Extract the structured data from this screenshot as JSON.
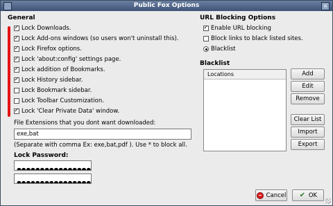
{
  "window": {
    "title": "Public Fox Options"
  },
  "general": {
    "title": "General",
    "options": [
      {
        "label": "Lock Downloads.",
        "checked": true
      },
      {
        "label": "Lock Add-ons windows (so users won't uninstall this).",
        "checked": true
      },
      {
        "label": "Lock Firefox options.",
        "checked": true
      },
      {
        "label": "Lock 'about:config' settings page.",
        "checked": true
      },
      {
        "label": "Lock addition of Bookmarks.",
        "checked": true
      },
      {
        "label": "Lock History sidebar.",
        "checked": true
      },
      {
        "label": "Lock Bookmark sidebar.",
        "checked": false
      },
      {
        "label": "Lock Toolbar Customization.",
        "checked": false
      },
      {
        "label": "Lock 'Clear Private Data' window.",
        "checked": true
      }
    ]
  },
  "extensions": {
    "label": "File Extensions that you dont want downloaded:",
    "value": "exe,bat",
    "help": "(Separate with comma Ex:  exe,bat,pdf ). Use * to block all."
  },
  "lock_password": {
    "label": "Lock Password:",
    "password_mask": "●●●●●●●●●●●●●●●●●●●●",
    "confirm_mask": "●●●●●●●●●●●●●●●●●●●●"
  },
  "url_blocking": {
    "title": "URL Blocking Options",
    "enable_label": "Enable URL blocking",
    "enable_checked": true,
    "block_links_label": "Block links to black listed sites.",
    "block_links_checked": false,
    "blacklist_radio_label": "Blacklist",
    "blacklist_selected": true
  },
  "blacklist": {
    "title": "Blacklist",
    "column_header": "Locations",
    "buttons": {
      "add": "Add",
      "edit": "Edit",
      "remove": "Remove",
      "clear": "Clear List",
      "import": "Import",
      "export": "Export"
    }
  },
  "footer": {
    "cancel": "Cancel",
    "ok": "OK"
  },
  "colors": {
    "accent_bar": "#e31414",
    "titlebar": "#4a5f82"
  }
}
